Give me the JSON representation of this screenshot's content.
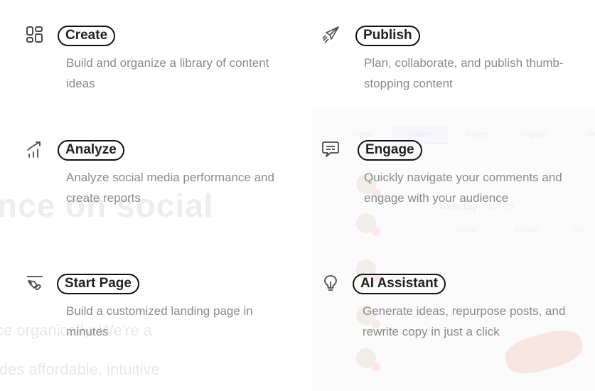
{
  "background": {
    "heading_fragment": "nce on social",
    "paragraph_line_1": "ce organically. We're a",
    "paragraph_line_2": "ides affordable, intuitive",
    "app_preview": {
      "tabs": [
        "Create",
        "Publish",
        "Analyze",
        "Engage",
        "Sta"
      ],
      "active_tab": "Publish",
      "date_day": "Tuesday",
      "date_rest": "Nov 24",
      "weekday_headers": [
        "Monday",
        "Tuesday",
        "We"
      ]
    }
  },
  "features": [
    {
      "id": "create",
      "icon": "grid-layout-icon",
      "title": "Create",
      "description": "Build and organize a library of content ideas"
    },
    {
      "id": "publish",
      "icon": "paper-plane-icon",
      "title": "Publish",
      "description": "Plan, collaborate, and publish thumb-stopping content"
    },
    {
      "id": "analyze",
      "icon": "chart-trend-icon",
      "title": "Analyze",
      "description": "Analyze social media performance and create reports"
    },
    {
      "id": "engage",
      "icon": "chat-bubble-icon",
      "title": "Engage",
      "description": "Quickly navigate your comments and engage with your audience"
    },
    {
      "id": "startpage",
      "icon": "pen-tool-icon",
      "title": "Start Page",
      "description": "Build a customized landing page in minutes"
    },
    {
      "id": "ai",
      "icon": "lightbulb-icon",
      "title": "AI Assistant",
      "description": "Generate ideas, repurpose posts, and rewrite copy in just a click"
    }
  ]
}
